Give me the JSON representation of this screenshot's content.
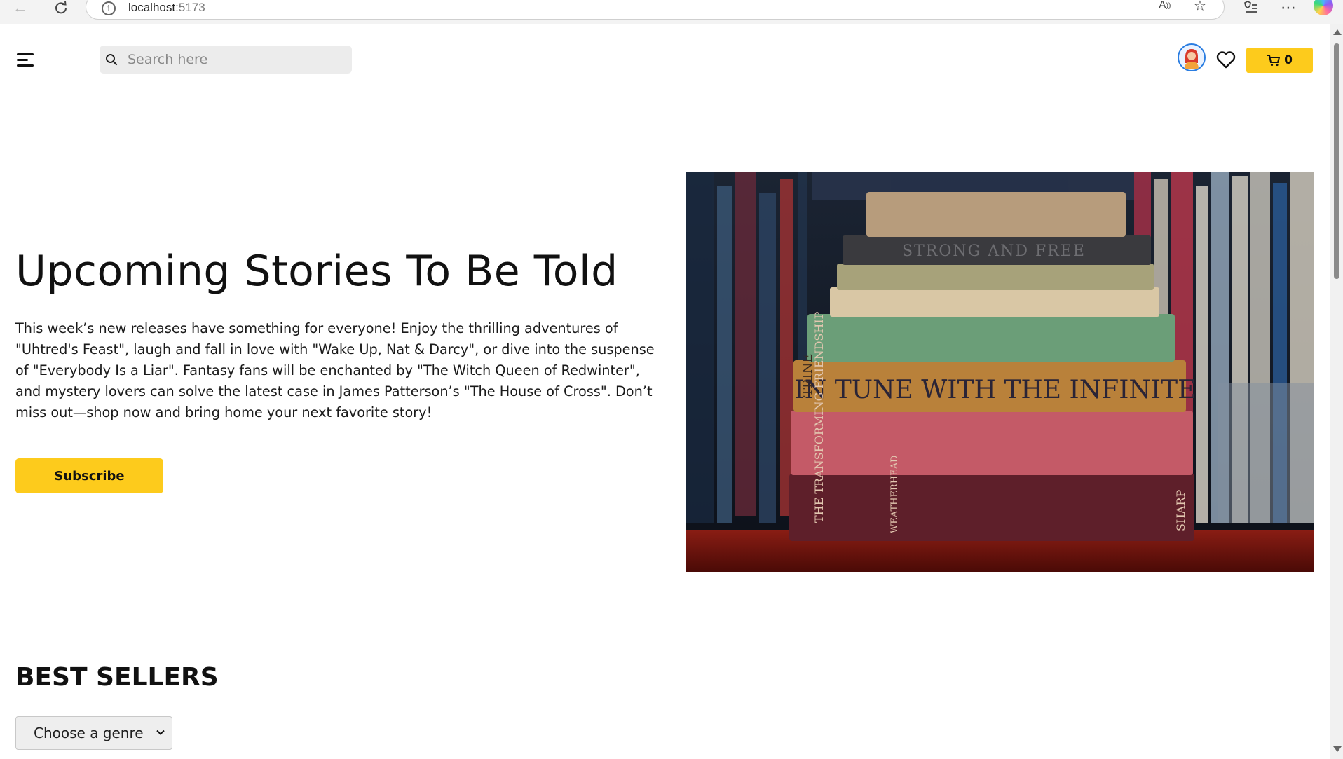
{
  "browser": {
    "url_host": "localhost",
    "url_port": ":5173"
  },
  "header": {
    "search_placeholder": "Search here",
    "cart_count": "0"
  },
  "hero": {
    "title": "Upcoming Stories To Be Told",
    "description": "This week’s new releases have something for everyone! Enjoy the thrilling adventures of \"Uhtred's Feast\", laugh and fall in love with \"Wake Up, Nat & Darcy\", or dive into the suspense of \"Everybody Is a Liar\". Fantasy fans will be enchanted by \"The Witch Queen of Redwinter\", and mystery lovers can solve the latest case in James Patterson’s \"The House of Cross\". Don’t miss out—shop now and bring home your next favorite story!",
    "subscribe_label": "Subscribe",
    "image_spine_texts": [
      "STRONG AND FREE",
      "IN TUNE WITH THE INFINITE",
      "THE TRANSFORMING FRIENDSHIP",
      "WEATHERHEAD",
      "SHARP",
      "TRINE"
    ]
  },
  "best_sellers": {
    "title": "BEST SELLERS",
    "genre_selected": "Choose a genre"
  },
  "colors": {
    "accent": "#fdcb1c",
    "avatar_ring": "#2a7de1"
  },
  "icons": {
    "menu": "hamburger-menu-icon",
    "search": "search-icon",
    "avatar": "user-avatar-icon",
    "wishlist": "heart-icon",
    "cart": "cart-icon",
    "select": "chevron-down-icon"
  }
}
